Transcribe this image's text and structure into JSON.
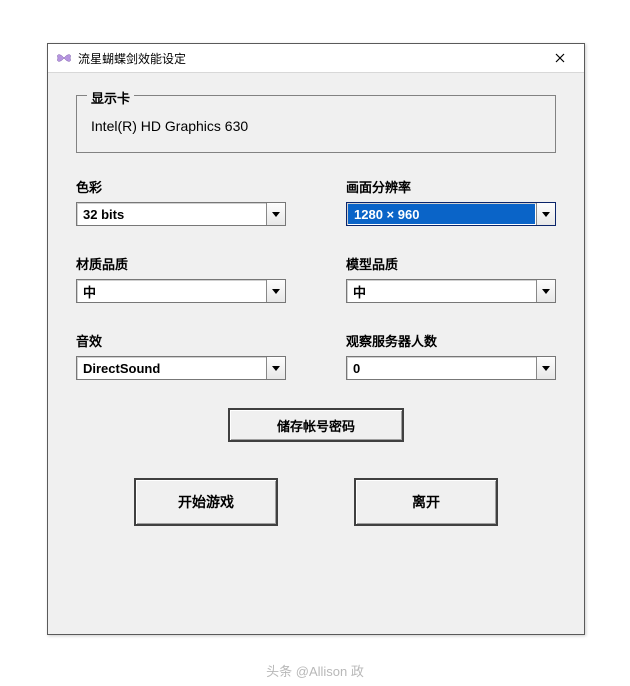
{
  "window": {
    "title": "流星蝴蝶剑效能设定"
  },
  "display": {
    "legend": "显示卡",
    "gpu": "Intel(R) HD Graphics 630"
  },
  "fields": {
    "color": {
      "label": "色彩",
      "value": "32 bits"
    },
    "resolution": {
      "label": "画面分辨率",
      "value": "1280 × 960"
    },
    "texture": {
      "label": "材质品质",
      "value": "中"
    },
    "model": {
      "label": "模型品质",
      "value": "中"
    },
    "sound": {
      "label": "音效",
      "value": "DirectSound"
    },
    "observers": {
      "label": "观察服务器人数",
      "value": "0"
    }
  },
  "buttons": {
    "save": "储存帐号密码",
    "start": "开始游戏",
    "exit": "离开"
  },
  "watermark": "头条 @Allison 政"
}
